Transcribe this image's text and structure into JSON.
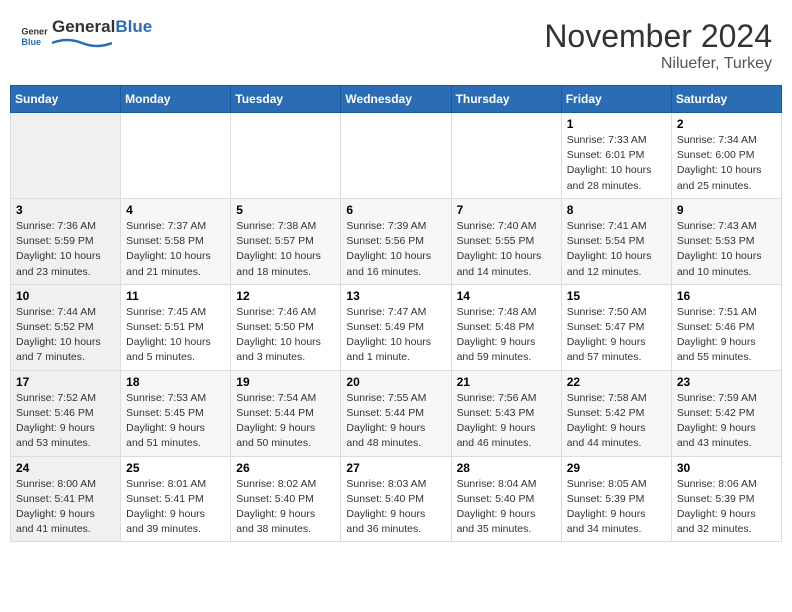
{
  "header": {
    "logo_general": "General",
    "logo_blue": "Blue",
    "month": "November 2024",
    "location": "Niluefer, Turkey"
  },
  "weekdays": [
    "Sunday",
    "Monday",
    "Tuesday",
    "Wednesday",
    "Thursday",
    "Friday",
    "Saturday"
  ],
  "weeks": [
    [
      {
        "day": "",
        "info": ""
      },
      {
        "day": "",
        "info": ""
      },
      {
        "day": "",
        "info": ""
      },
      {
        "day": "",
        "info": ""
      },
      {
        "day": "",
        "info": ""
      },
      {
        "day": "1",
        "info": "Sunrise: 7:33 AM\nSunset: 6:01 PM\nDaylight: 10 hours and 28 minutes."
      },
      {
        "day": "2",
        "info": "Sunrise: 7:34 AM\nSunset: 6:00 PM\nDaylight: 10 hours and 25 minutes."
      }
    ],
    [
      {
        "day": "3",
        "info": "Sunrise: 7:36 AM\nSunset: 5:59 PM\nDaylight: 10 hours and 23 minutes."
      },
      {
        "day": "4",
        "info": "Sunrise: 7:37 AM\nSunset: 5:58 PM\nDaylight: 10 hours and 21 minutes."
      },
      {
        "day": "5",
        "info": "Sunrise: 7:38 AM\nSunset: 5:57 PM\nDaylight: 10 hours and 18 minutes."
      },
      {
        "day": "6",
        "info": "Sunrise: 7:39 AM\nSunset: 5:56 PM\nDaylight: 10 hours and 16 minutes."
      },
      {
        "day": "7",
        "info": "Sunrise: 7:40 AM\nSunset: 5:55 PM\nDaylight: 10 hours and 14 minutes."
      },
      {
        "day": "8",
        "info": "Sunrise: 7:41 AM\nSunset: 5:54 PM\nDaylight: 10 hours and 12 minutes."
      },
      {
        "day": "9",
        "info": "Sunrise: 7:43 AM\nSunset: 5:53 PM\nDaylight: 10 hours and 10 minutes."
      }
    ],
    [
      {
        "day": "10",
        "info": "Sunrise: 7:44 AM\nSunset: 5:52 PM\nDaylight: 10 hours and 7 minutes."
      },
      {
        "day": "11",
        "info": "Sunrise: 7:45 AM\nSunset: 5:51 PM\nDaylight: 10 hours and 5 minutes."
      },
      {
        "day": "12",
        "info": "Sunrise: 7:46 AM\nSunset: 5:50 PM\nDaylight: 10 hours and 3 minutes."
      },
      {
        "day": "13",
        "info": "Sunrise: 7:47 AM\nSunset: 5:49 PM\nDaylight: 10 hours and 1 minute."
      },
      {
        "day": "14",
        "info": "Sunrise: 7:48 AM\nSunset: 5:48 PM\nDaylight: 9 hours and 59 minutes."
      },
      {
        "day": "15",
        "info": "Sunrise: 7:50 AM\nSunset: 5:47 PM\nDaylight: 9 hours and 57 minutes."
      },
      {
        "day": "16",
        "info": "Sunrise: 7:51 AM\nSunset: 5:46 PM\nDaylight: 9 hours and 55 minutes."
      }
    ],
    [
      {
        "day": "17",
        "info": "Sunrise: 7:52 AM\nSunset: 5:46 PM\nDaylight: 9 hours and 53 minutes."
      },
      {
        "day": "18",
        "info": "Sunrise: 7:53 AM\nSunset: 5:45 PM\nDaylight: 9 hours and 51 minutes."
      },
      {
        "day": "19",
        "info": "Sunrise: 7:54 AM\nSunset: 5:44 PM\nDaylight: 9 hours and 50 minutes."
      },
      {
        "day": "20",
        "info": "Sunrise: 7:55 AM\nSunset: 5:44 PM\nDaylight: 9 hours and 48 minutes."
      },
      {
        "day": "21",
        "info": "Sunrise: 7:56 AM\nSunset: 5:43 PM\nDaylight: 9 hours and 46 minutes."
      },
      {
        "day": "22",
        "info": "Sunrise: 7:58 AM\nSunset: 5:42 PM\nDaylight: 9 hours and 44 minutes."
      },
      {
        "day": "23",
        "info": "Sunrise: 7:59 AM\nSunset: 5:42 PM\nDaylight: 9 hours and 43 minutes."
      }
    ],
    [
      {
        "day": "24",
        "info": "Sunrise: 8:00 AM\nSunset: 5:41 PM\nDaylight: 9 hours and 41 minutes."
      },
      {
        "day": "25",
        "info": "Sunrise: 8:01 AM\nSunset: 5:41 PM\nDaylight: 9 hours and 39 minutes."
      },
      {
        "day": "26",
        "info": "Sunrise: 8:02 AM\nSunset: 5:40 PM\nDaylight: 9 hours and 38 minutes."
      },
      {
        "day": "27",
        "info": "Sunrise: 8:03 AM\nSunset: 5:40 PM\nDaylight: 9 hours and 36 minutes."
      },
      {
        "day": "28",
        "info": "Sunrise: 8:04 AM\nSunset: 5:40 PM\nDaylight: 9 hours and 35 minutes."
      },
      {
        "day": "29",
        "info": "Sunrise: 8:05 AM\nSunset: 5:39 PM\nDaylight: 9 hours and 34 minutes."
      },
      {
        "day": "30",
        "info": "Sunrise: 8:06 AM\nSunset: 5:39 PM\nDaylight: 9 hours and 32 minutes."
      }
    ]
  ]
}
